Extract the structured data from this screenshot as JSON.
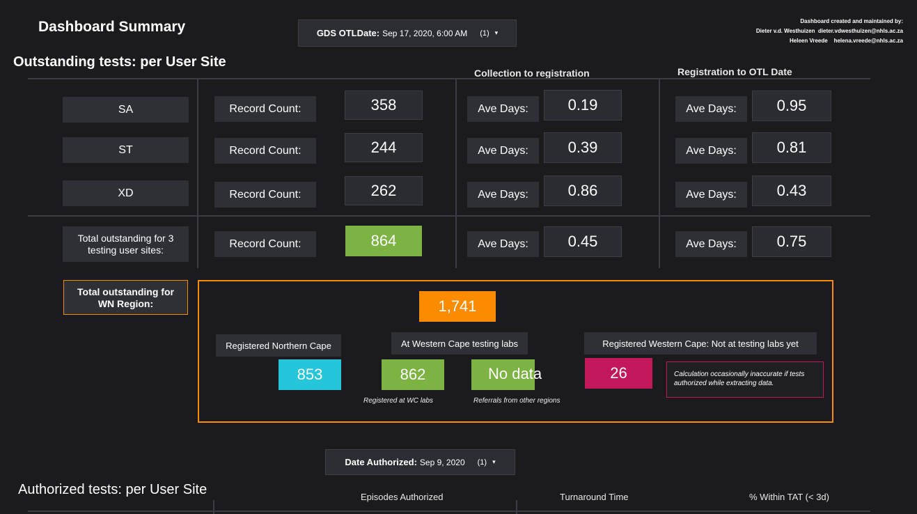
{
  "header": {
    "title": "Dashboard Summary",
    "gds_filter": {
      "label": "GDS OTLDate:",
      "value": "Sep 17, 2020, 6:00 AM",
      "count": "(1)"
    },
    "credits": {
      "line1": "Dashboard created and maintained by:",
      "line2_name": "Dieter v.d. Westhuizen",
      "line2_email": "dieter.vdwesthuizen@nhls.ac.za",
      "line3_name": "Heleen Vreede",
      "line3_email": "helena.vreede@nhls.ac.za"
    }
  },
  "outstanding": {
    "section_title": "Outstanding tests: per User Site",
    "col_headers": {
      "collection": "Collection to registration",
      "registration": "Registration to OTL Date"
    },
    "record_label": "Record Count:",
    "ave_label": "Ave Days:",
    "rows": [
      {
        "site": "SA",
        "records": "358",
        "collection_days": "0.19",
        "registration_days": "0.95"
      },
      {
        "site": "ST",
        "records": "244",
        "collection_days": "0.39",
        "registration_days": "0.81"
      },
      {
        "site": "XD",
        "records": "262",
        "collection_days": "0.86",
        "registration_days": "0.43"
      }
    ],
    "total": {
      "label": "Total outstanding for 3 testing user sites:",
      "records": "864",
      "collection_days": "0.45",
      "registration_days": "0.75"
    }
  },
  "region": {
    "label": "Total outstanding for WN Region:",
    "total": "1,741",
    "registered_nc_label": "Registered Northern Cape",
    "registered_nc_value": "853",
    "wc_labs_label": "At Western Cape testing labs",
    "wc_labs_value": "862",
    "wc_labs_note": "Registered at WC labs",
    "referrals_value": "No data",
    "referrals_note": "Referrals from other regions",
    "not_at_labs_label": "Registered Western Cape: Not at testing labs yet",
    "not_at_labs_value": "26",
    "warning": "Calculation occasionally inaccurate if tests authorized while extracting data."
  },
  "authorized": {
    "filter": {
      "label": "Date Authorized:",
      "value": "Sep 9, 2020",
      "count": "(1)"
    },
    "section_title": "Authorized tests: per User Site",
    "col_episodes": "Episodes Authorized",
    "col_turnaround": "Turnaround Time",
    "col_within": "% Within TAT (< 3d)"
  },
  "colors": {
    "background": "#1b1b1e",
    "green": "#7cb342",
    "orange": "#fb8c00",
    "cyan": "#26c6da",
    "magenta": "#c2185b"
  }
}
